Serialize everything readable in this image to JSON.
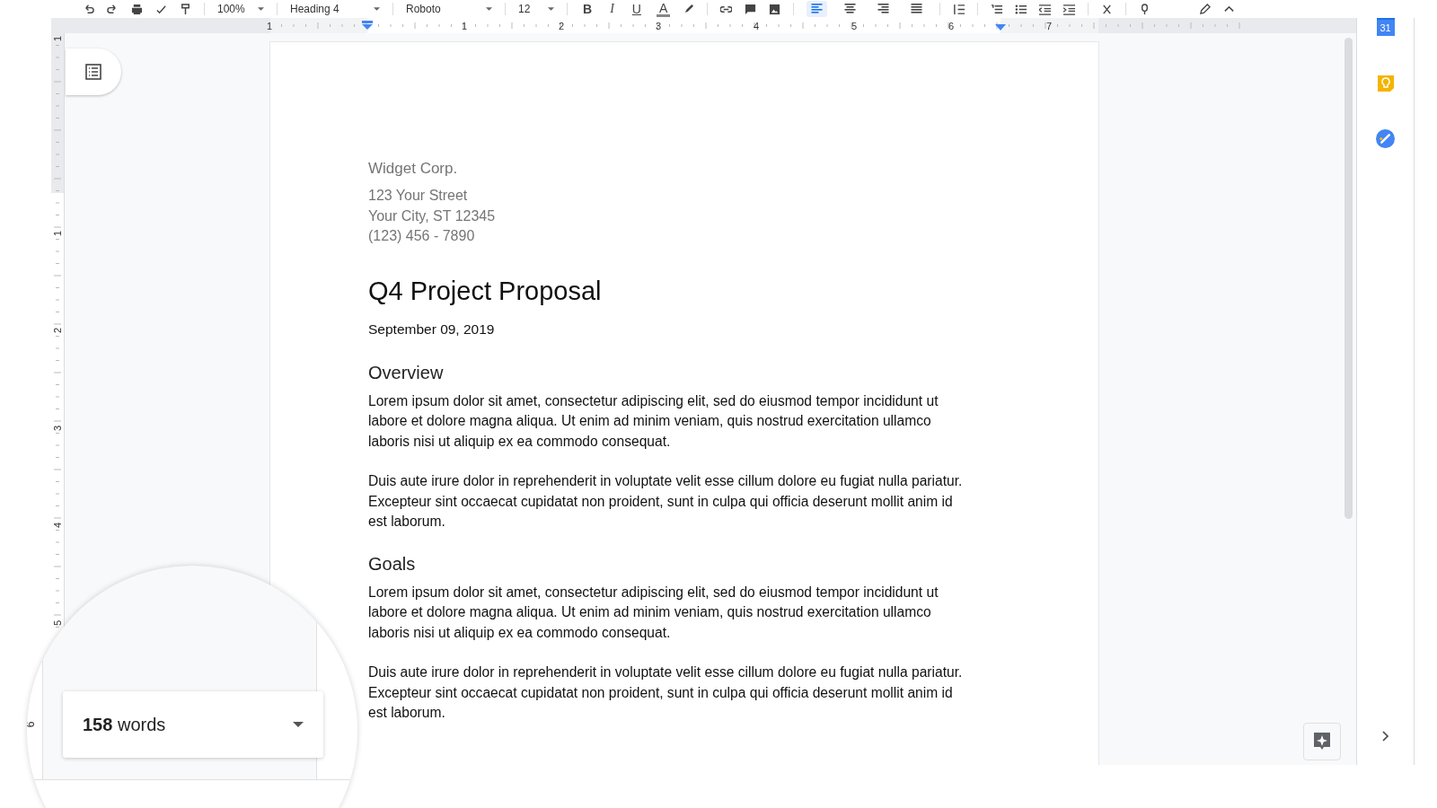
{
  "toolbar": {
    "dropdowns": [
      {
        "kind": "zoom",
        "value": "100%"
      },
      {
        "kind": "style",
        "value": "Heading 4"
      },
      {
        "kind": "font",
        "value": "Roboto"
      },
      {
        "kind": "size",
        "value": "12"
      }
    ],
    "format_letters": [
      {
        "kind": "bold",
        "text": "B"
      },
      {
        "kind": "italic",
        "text": "I"
      },
      {
        "kind": "underline",
        "text": "U"
      },
      {
        "kind": "color",
        "text": "A"
      }
    ],
    "alignment": [
      {
        "kind": "left",
        "selected": true
      },
      {
        "kind": "center",
        "selected": false
      },
      {
        "kind": "right",
        "selected": false
      },
      {
        "kind": "justify",
        "selected": false
      }
    ]
  },
  "ruler": {
    "horizontal_labels": [
      "1",
      "1",
      "2",
      "3",
      "4",
      "5",
      "6",
      "7"
    ],
    "vertical_labels": [
      "1",
      "1",
      "2",
      "3",
      "4",
      "5"
    ]
  },
  "document": {
    "company": "Widget Corp.",
    "address_lines": [
      "123 Your Street",
      "Your City, ST 12345",
      "(123) 456 - 7890"
    ],
    "title": "Q4 Project Proposal",
    "date": "September 09, 2019",
    "sections": [
      {
        "heading": "Overview",
        "paragraphs": [
          "Lorem ipsum dolor sit amet, consectetur adipiscing elit, sed do eiusmod tempor incididunt ut labore et dolore magna aliqua. Ut enim ad minim veniam, quis nostrud exercitation ullamco laboris nisi ut aliquip ex ea commodo consequat.",
          "Duis aute irure dolor in reprehenderit in voluptate velit esse cillum dolore eu fugiat nulla pariatur. Excepteur sint occaecat cupidatat non proident, sunt in culpa qui officia deserunt mollit anim id est laborum."
        ]
      },
      {
        "heading": "Goals",
        "paragraphs": [
          "Lorem ipsum dolor sit amet, consectetur adipiscing elit, sed do eiusmod tempor incididunt ut labore et dolore magna aliqua. Ut enim ad minim veniam, quis nostrud exercitation ullamco laboris nisi ut aliquip ex ea commodo consequat.",
          "Duis aute irure dolor in reprehenderit in voluptate velit esse cillum dolore eu fugiat nulla pariatur. Excepteur sint occaecat cupidatat non proident, sunt in culpa qui officia deserunt mollit anim id est laborum."
        ]
      }
    ]
  },
  "side_panel": {
    "calendar_day": "31"
  },
  "magnifier": {
    "ruler_label": "6",
    "word_count": "**158** words"
  }
}
